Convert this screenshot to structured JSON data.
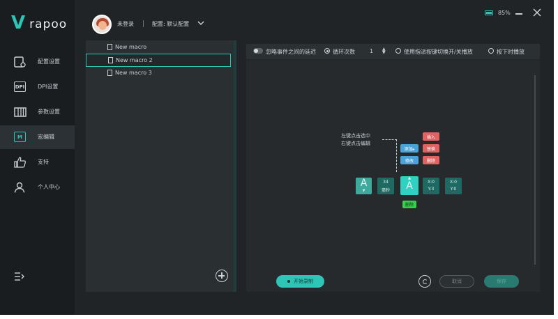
{
  "app": {
    "brand": "rapoo",
    "logo_mark": "V"
  },
  "header": {
    "username": "未登录",
    "config_label": "配置: 默认配置",
    "battery_pct": "85%",
    "battery_level": 0.85
  },
  "sidebar": {
    "items": [
      {
        "label": "配置设置",
        "icon": "config-icon"
      },
      {
        "label": "DPI设置",
        "icon": "dpi-icon",
        "icon_text": "DPI"
      },
      {
        "label": "参数设置",
        "icon": "params-icon"
      },
      {
        "label": "宏编辑",
        "icon": "macro-icon",
        "icon_text": "M",
        "active": true
      },
      {
        "label": "支持",
        "icon": "thumbs-up-icon"
      },
      {
        "label": "个人中心",
        "icon": "user-icon"
      }
    ]
  },
  "macros": {
    "items": [
      {
        "name": "New macro"
      },
      {
        "name": "New macro 2",
        "selected": true
      },
      {
        "name": "New macro 3"
      }
    ]
  },
  "options": {
    "ignore_delay_label": "忽略事件之间的延迟",
    "loop_label": "循环次数",
    "loop_count": "1",
    "toggle_label": "使用指派按键切换开/关播放",
    "hold_label": "按下时播放"
  },
  "editor": {
    "hint_line1": "左键点击选中",
    "hint_line2": "右键点击编辑",
    "tags": {
      "insert": "插入",
      "replace": "替换",
      "delete_red": "删除",
      "add_before": "添加▸",
      "modify": "修改",
      "delete_green": "删除"
    },
    "nodes": {
      "key_a": "A",
      "delay_value": "34",
      "delay_unit": "毫秒",
      "key_a2": "A",
      "x0": "X:0",
      "y3": "Y:3",
      "x0b": "X:0",
      "y0": "Y:0"
    }
  },
  "footer": {
    "record_label": "开始录制",
    "cancel_label": "取消",
    "confirm_label": "保存"
  },
  "colors": {
    "accent": "#2ec4b6",
    "danger": "#e06363",
    "info": "#4aa3d9",
    "success": "#35d04b"
  }
}
